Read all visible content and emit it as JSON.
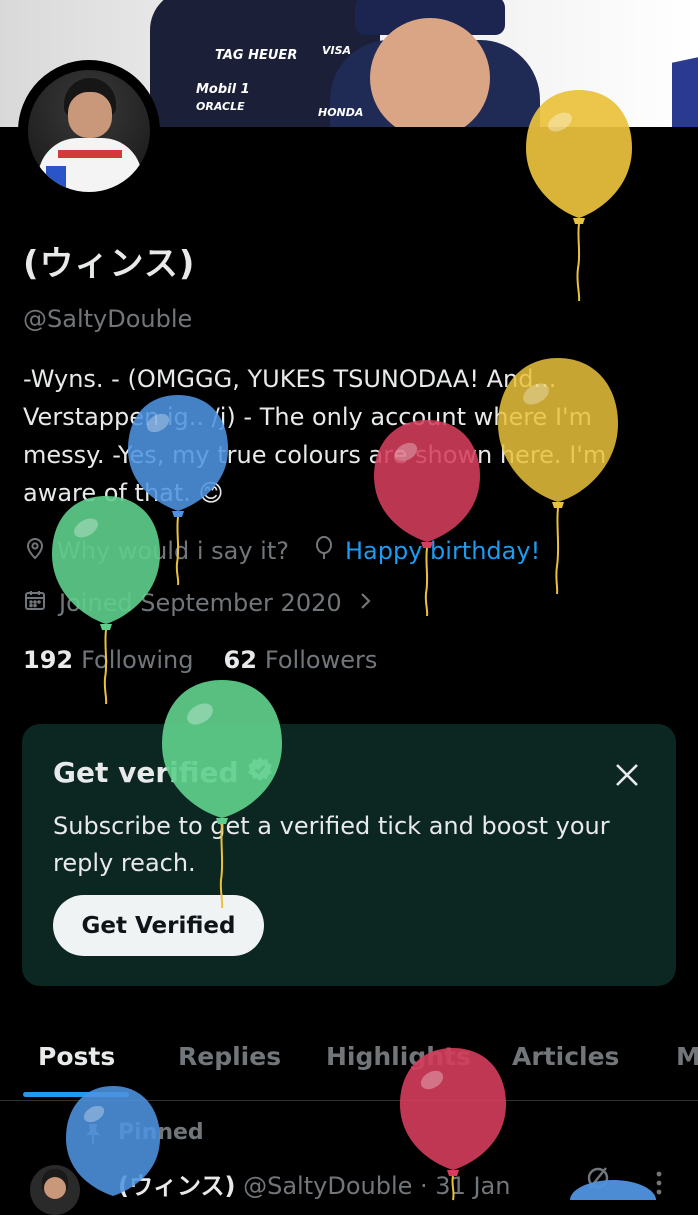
{
  "banner": {
    "logos": [
      "TAG HEUER",
      "Mobil 1",
      "ORACLE",
      "HONDA",
      "VISA"
    ]
  },
  "profile": {
    "name": "(ウィンス)",
    "handle": "@SaltyDouble",
    "bio_line1": "-Wyns. - (OMGGG, YUKES TSUNODAA! And...",
    "bio_line2": "Verstappen ig.. /j) - The only account where I'm",
    "bio_line3": "messy. -Yes, my true colours are shown here. I'm",
    "bio_line4": "aware of that. 😊",
    "location": "Why would i say it?",
    "birthday": "Happy birthday!",
    "joined": "Joined September 2020"
  },
  "stats": {
    "following_count": "192",
    "following_label": "Following",
    "followers_count": "62",
    "followers_label": "Followers"
  },
  "verify_card": {
    "title": "Get verified",
    "body": "Subscribe to get a verified tick and boost your reply reach.",
    "button_label": "Get Verified"
  },
  "tabs": [
    "Posts",
    "Replies",
    "Highlights",
    "Articles",
    "M"
  ],
  "post": {
    "pinned_label": "Pinned",
    "author_name": "(ウィンス)",
    "author_handle": "@SaltyDouble",
    "separator": "·",
    "date": "31 Jan"
  },
  "balloon_colors": {
    "yellow": "#e9c23c",
    "red": "#d53d5c",
    "blue": "#4f93e0",
    "green": "#5fcf8c"
  },
  "colors": {
    "accent": "#1d9bf0",
    "card_bg": "#0c2621",
    "muted": "#71767b",
    "text": "#e7e9ea"
  }
}
